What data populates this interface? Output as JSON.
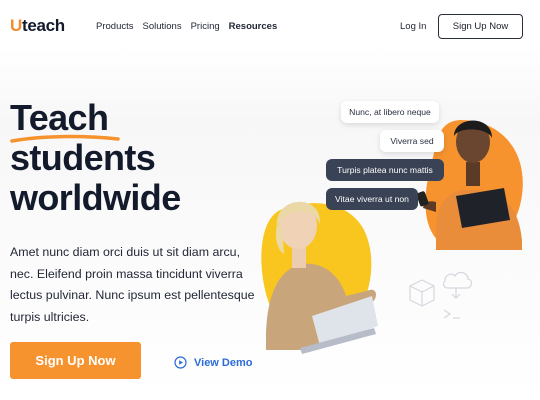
{
  "brand": {
    "logo_u": "U",
    "logo_rest": "teach",
    "accent": "#f6932f",
    "link_color": "#2c6bd8"
  },
  "nav": {
    "links": [
      "Products",
      "Solutions",
      "Pricing",
      "Resources"
    ],
    "login_label": "Log In",
    "signup_label": "Sign Up Now"
  },
  "hero": {
    "headline": [
      "Teach",
      "students",
      "worldwide"
    ],
    "description": "Amet nunc diam orci duis ut sit diam arcu, nec. Eleifend proin massa tincidunt viverra lectus pulvinar. Nunc ipsum est pellentesque turpis ultricies.",
    "cta_label": "Sign Up Now",
    "demo_label": "View Demo"
  },
  "chat_bubbles": [
    "Nunc, at libero neque",
    "Viverra sed",
    "Turpis platea nunc mattis",
    "Vitae viverra ut non"
  ],
  "icons": [
    "play-circle-icon",
    "cube-icon",
    "cloud-icon",
    "terminal-icon"
  ]
}
